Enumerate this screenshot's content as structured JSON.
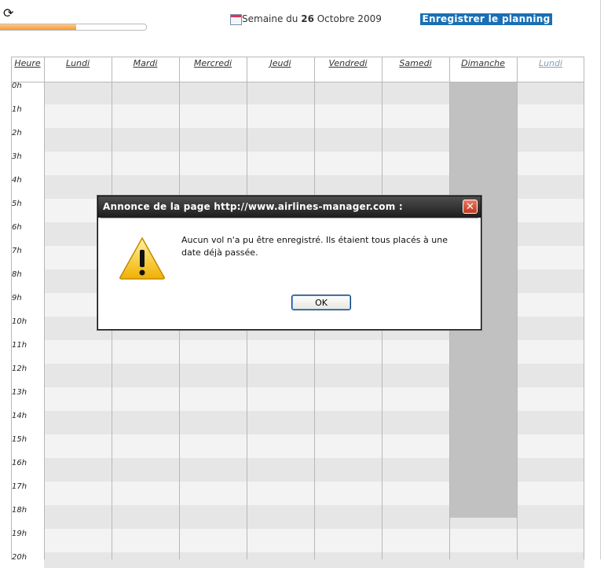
{
  "toolbar": {
    "refresh_icon": "refresh-icon",
    "progress_value": 0.52,
    "week_prefix": "Semaine du ",
    "week_day": "26",
    "week_suffix": " Octobre 2009",
    "save_label": "Enregistrer le planning",
    "save_color": "#1a6fb5"
  },
  "planning": {
    "header": [
      "Heure",
      "Lundi",
      "Mardi",
      "Mercredi",
      "Jeudi",
      "Vendredi",
      "Samedi",
      "Dimanche",
      "Lundi"
    ],
    "hours": [
      "0h",
      "1h",
      "2h",
      "3h",
      "4h",
      "5h",
      "6h",
      "7h",
      "8h",
      "9h",
      "10h",
      "11h",
      "12h",
      "13h",
      "14h",
      "15h",
      "16h",
      "17h",
      "18h",
      "19h",
      "20h"
    ]
  },
  "dialog": {
    "title": "Annonce de la page http://www.airlines-manager.com :",
    "message": "Aucun vol n'a pu être enregistré. Ils étaient tous placés à une date déjà passée.",
    "ok_label": "OK",
    "icon": "warning-icon",
    "close_icon": "close-icon"
  }
}
